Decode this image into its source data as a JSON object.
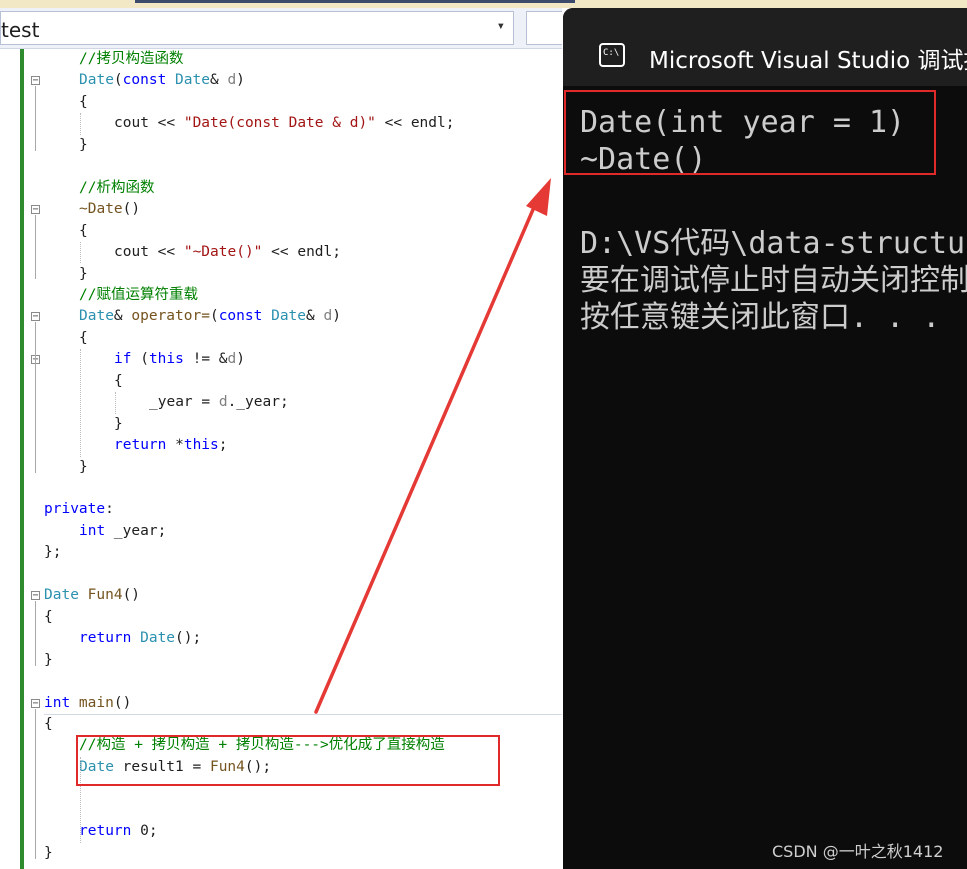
{
  "scope_dropdown": {
    "text": "test",
    "arrow": "▾"
  },
  "code_lines": [
    [
      {
        "c": "cm",
        "t": "//拷贝构造函数"
      }
    ],
    [
      {
        "c": "ty",
        "t": "Date"
      },
      {
        "c": "tx",
        "t": "("
      },
      {
        "c": "kw",
        "t": "const "
      },
      {
        "c": "ty",
        "t": "Date"
      },
      {
        "c": "tx",
        "t": "& "
      },
      {
        "c": "pm",
        "t": "d"
      },
      {
        "c": "tx",
        "t": ")"
      }
    ],
    [
      {
        "c": "tx",
        "t": "{"
      }
    ],
    [
      {
        "c": "tx",
        "t": "cout << "
      },
      {
        "c": "st",
        "t": "\"Date(const Date & d)\""
      },
      {
        "c": "tx",
        "t": " << endl;"
      }
    ],
    [
      {
        "c": "tx",
        "t": "}"
      }
    ],
    [],
    [
      {
        "c": "cm",
        "t": "//析构函数"
      }
    ],
    [
      {
        "c": "fn",
        "t": "~Date"
      },
      {
        "c": "tx",
        "t": "()"
      }
    ],
    [
      {
        "c": "tx",
        "t": "{"
      }
    ],
    [
      {
        "c": "tx",
        "t": "cout << "
      },
      {
        "c": "st",
        "t": "\"~Date()\""
      },
      {
        "c": "tx",
        "t": " << endl;"
      }
    ],
    [
      {
        "c": "tx",
        "t": "}"
      }
    ],
    [
      {
        "c": "cm",
        "t": "//赋值运算符重载"
      }
    ],
    [
      {
        "c": "ty",
        "t": "Date"
      },
      {
        "c": "tx",
        "t": "& "
      },
      {
        "c": "fn",
        "t": "operator="
      },
      {
        "c": "tx",
        "t": "("
      },
      {
        "c": "kw",
        "t": "const "
      },
      {
        "c": "ty",
        "t": "Date"
      },
      {
        "c": "tx",
        "t": "& "
      },
      {
        "c": "pm",
        "t": "d"
      },
      {
        "c": "tx",
        "t": ")"
      }
    ],
    [
      {
        "c": "tx",
        "t": "{"
      }
    ],
    [
      {
        "c": "kw",
        "t": "if "
      },
      {
        "c": "tx",
        "t": "("
      },
      {
        "c": "kw",
        "t": "this"
      },
      {
        "c": "tx",
        "t": " != &"
      },
      {
        "c": "pm",
        "t": "d"
      },
      {
        "c": "tx",
        "t": ")"
      }
    ],
    [
      {
        "c": "tx",
        "t": "{"
      }
    ],
    [
      {
        "c": "tx",
        "t": "_year = "
      },
      {
        "c": "pm",
        "t": "d"
      },
      {
        "c": "tx",
        "t": "._year;"
      }
    ],
    [
      {
        "c": "tx",
        "t": "}"
      }
    ],
    [
      {
        "c": "kw",
        "t": "return "
      },
      {
        "c": "tx",
        "t": "*"
      },
      {
        "c": "kw",
        "t": "this"
      },
      {
        "c": "tx",
        "t": ";"
      }
    ],
    [
      {
        "c": "tx",
        "t": "}"
      }
    ],
    [],
    [
      {
        "c": "kw",
        "t": "private"
      },
      {
        "c": "tx",
        "t": ":"
      }
    ],
    [
      {
        "c": "kw",
        "t": "int "
      },
      {
        "c": "tx",
        "t": "_year;"
      }
    ],
    [
      {
        "c": "tx",
        "t": "};"
      }
    ],
    [],
    [
      {
        "c": "ty",
        "t": "Date "
      },
      {
        "c": "fn",
        "t": "Fun4"
      },
      {
        "c": "tx",
        "t": "()"
      }
    ],
    [
      {
        "c": "tx",
        "t": "{"
      }
    ],
    [
      {
        "c": "kw",
        "t": "return "
      },
      {
        "c": "ty",
        "t": "Date"
      },
      {
        "c": "tx",
        "t": "();"
      }
    ],
    [
      {
        "c": "tx",
        "t": "}"
      }
    ],
    [],
    [
      {
        "c": "kw",
        "t": "int "
      },
      {
        "c": "fn",
        "t": "main"
      },
      {
        "c": "tx",
        "t": "()"
      }
    ],
    [
      {
        "c": "tx",
        "t": "{"
      }
    ],
    [
      {
        "c": "cm",
        "t": "//构造 + 拷贝构造 + 拷贝构造--->优化成了直接构造"
      }
    ],
    [
      {
        "c": "ty",
        "t": "Date "
      },
      {
        "c": "tx",
        "t": "result1 = "
      },
      {
        "c": "fn",
        "t": "Fun4"
      },
      {
        "c": "tx",
        "t": "();"
      }
    ],
    [],
    [],
    [
      {
        "c": "kw",
        "t": "return "
      },
      {
        "c": "tx",
        "t": "0;"
      }
    ],
    [
      {
        "c": "tx",
        "t": "}"
      }
    ]
  ],
  "console": {
    "title": "Microsoft Visual Studio 调试控制台",
    "icon": "cmd-icon",
    "icon_label": "C:\\",
    "lines": [
      "Date(int year = 1)",
      "~Date()",
      "",
      "D:\\VS代码\\data-structure\\",
      "要在调试停止时自动关闭控制台",
      "按任意键关闭此窗口. . ."
    ]
  },
  "watermark": "CSDN @一叶之秋1412",
  "colors": {
    "highlight_box": "#e02a2a",
    "arrow": "#e53935",
    "gutter_green": "#2e8b2e",
    "console_bg": "#0c0c0c"
  }
}
